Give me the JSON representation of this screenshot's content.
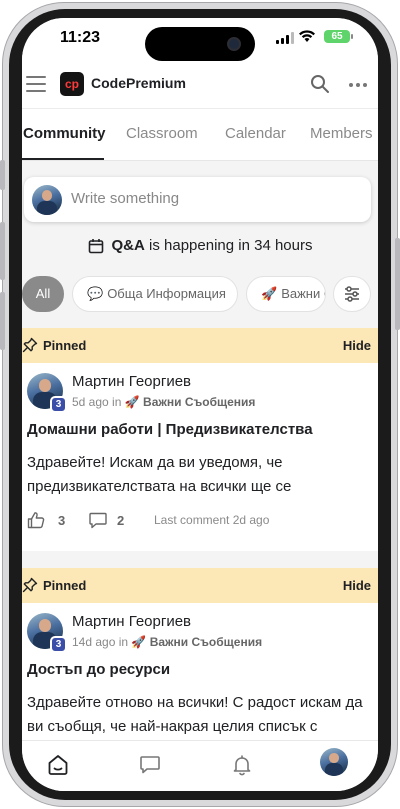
{
  "status_bar": {
    "time": "11:23",
    "battery": "65"
  },
  "app": {
    "name": "CodePremium",
    "logo_text": "cp"
  },
  "tabs": [
    {
      "label": "Community",
      "active": true
    },
    {
      "label": "Classroom",
      "active": false
    },
    {
      "label": "Calendar",
      "active": false
    },
    {
      "label": "Members",
      "active": false
    }
  ],
  "composer": {
    "placeholder": "Write something"
  },
  "event": {
    "name": "Q&A",
    "text": "is happening in 34 hours"
  },
  "filters": {
    "all": "All",
    "chips": [
      {
        "emoji": "💬",
        "label": "Обща Информация"
      },
      {
        "emoji": "🚀",
        "label": "Важни С"
      }
    ]
  },
  "posts": [
    {
      "pinned_label": "Pinned",
      "hide_label": "Hide",
      "author": "Мартин Георгиев",
      "level": "3",
      "time": "5d ago in",
      "category_emoji": "🚀",
      "category": "Важни Съобщения",
      "title": "Домашни работи | Предизвикателства",
      "body": "Здравейте! Искам да ви уведомя, че предизвикателствата на всички ще се",
      "likes": "3",
      "comments": "2",
      "last_comment": "Last comment 2d ago"
    },
    {
      "pinned_label": "Pinned",
      "hide_label": "Hide",
      "author": "Мартин Георгиев",
      "level": "3",
      "time": "14d ago in",
      "category_emoji": "🚀",
      "category": "Важни Съобщения",
      "title": "Достъп до ресурси",
      "body": "Здравейте отново на всички! С радост искам да ви съобщя, че най-накрая целия списък с"
    }
  ],
  "colors": {
    "pinned_bg": "#fbe8b6",
    "level_badge": "#3b4fa8",
    "tab_active": "#202124",
    "battery": "#5fd46a"
  },
  "icons": [
    "menu-icon",
    "search-icon",
    "more-icon",
    "calendar-icon",
    "filter-settings-icon",
    "pin-icon",
    "like-icon",
    "comment-icon",
    "home-icon",
    "chat-icon",
    "bell-icon"
  ]
}
